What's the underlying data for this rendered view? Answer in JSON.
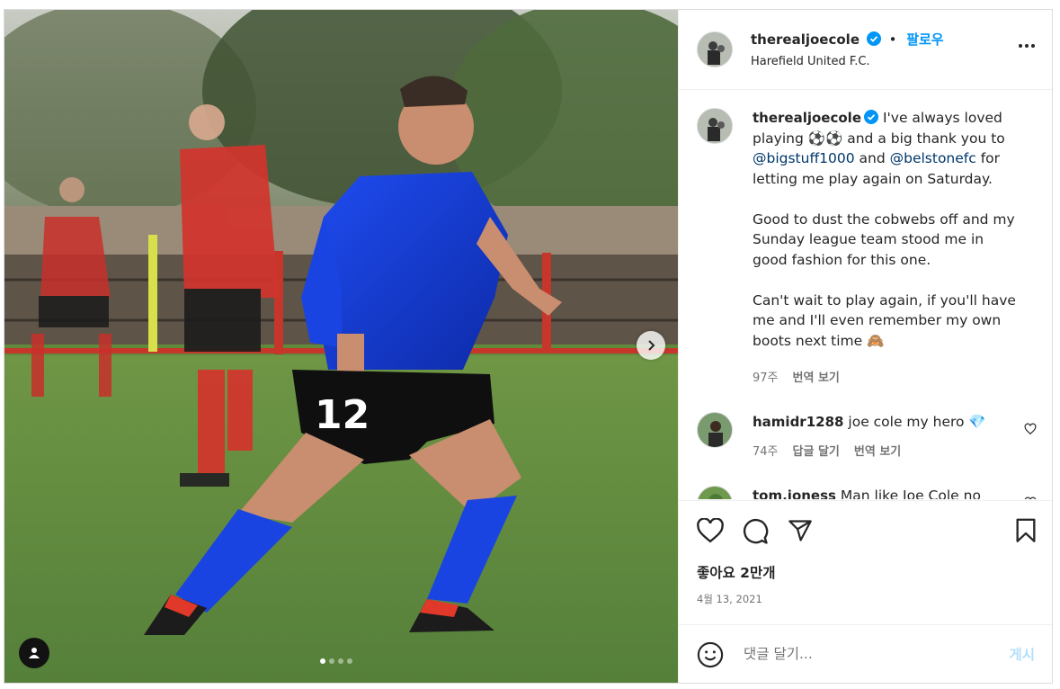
{
  "post": {
    "username": "therealjoecole",
    "follow_label": "팔로우",
    "separator": "•",
    "location": "Harefield United F.C.",
    "verified": true
  },
  "caption": {
    "username": "therealjoecole",
    "text_parts": [
      {
        "type": "text",
        "value": "I've always loved playing ⚽⚽ and a big thank you to "
      },
      {
        "type": "mention",
        "value": "@bigstuff1000"
      },
      {
        "type": "text",
        "value": " and "
      },
      {
        "type": "mention",
        "value": "@belstonefc"
      },
      {
        "type": "text",
        "value": " for letting me play again on Saturday.\n\nGood to dust the cobwebs off and my Sunday league team stood me in good fashion for this one.\n\nCan't wait to play again, if you'll have me and I'll even remember my own boots next time 🙈"
      }
    ],
    "time": "97주",
    "translate_label": "번역 보기"
  },
  "comments": [
    {
      "username": "hamidr1288",
      "text": "joe cole my hero 💎",
      "time": "74주",
      "reply_label": "답글 달기",
      "translate_label": "번역 보기"
    },
    {
      "username": "tom.joness",
      "text": "Man like Joe Cole no"
    }
  ],
  "likes_label": "좋아요 2만개",
  "date_label": "4월 13, 2021",
  "comment_box": {
    "placeholder": "댓글 달기...",
    "post_label": "게시"
  },
  "media": {
    "jersey_number": "12",
    "carousel_count": 4,
    "active_index": 0
  },
  "colors": {
    "accent": "#0095f6",
    "mention": "#00376b",
    "home_kit": "#1a3fe0",
    "away_kit": "#d42a2a",
    "pitch": "#5f8a3c"
  }
}
